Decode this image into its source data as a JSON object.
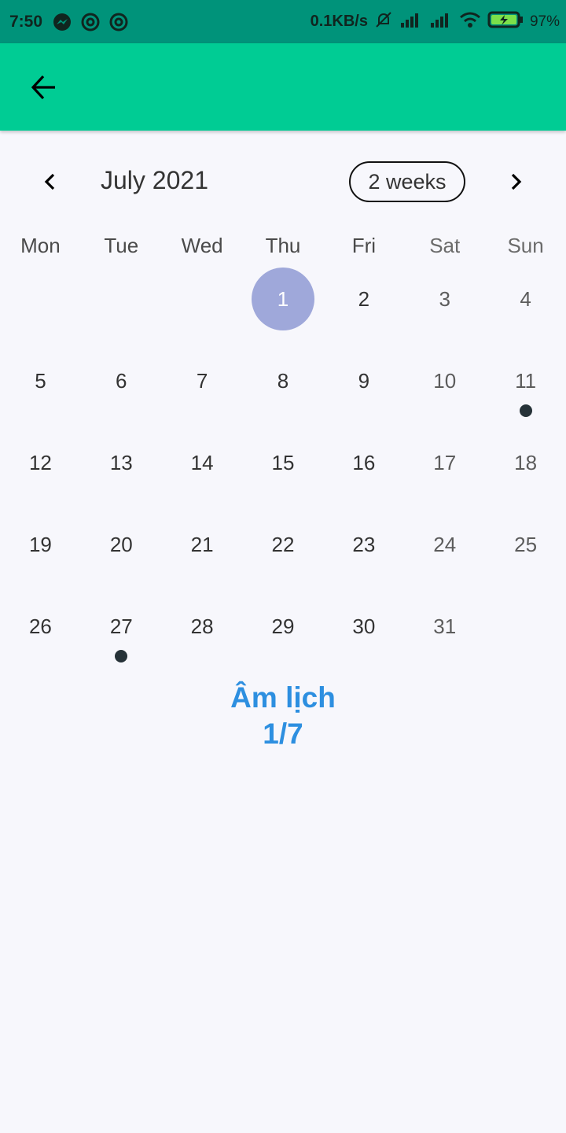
{
  "status_bar": {
    "time": "7:50",
    "network_speed": "0.1KB/s",
    "battery": "97%",
    "app_icons": [
      "messenger-icon",
      "notification-app-icon",
      "notification-app-icon"
    ],
    "colors": {
      "background": "#00937a"
    }
  },
  "app_bar": {
    "color": "#00cc94",
    "back_icon": "arrow-left-icon"
  },
  "calendar": {
    "month_title": "July 2021",
    "format_button": "2 weeks",
    "weekdays": [
      "Mon",
      "Tue",
      "Wed",
      "Thu",
      "Fri",
      "Sat",
      "Sun"
    ],
    "leading_blank_days": 3,
    "days": [
      "1",
      "2",
      "3",
      "4",
      "5",
      "6",
      "7",
      "8",
      "9",
      "10",
      "11",
      "12",
      "13",
      "14",
      "15",
      "16",
      "17",
      "18",
      "19",
      "20",
      "21",
      "22",
      "23",
      "24",
      "25",
      "26",
      "27",
      "28",
      "29",
      "30",
      "31"
    ],
    "selected_day": "1",
    "event_days": [
      "11",
      "27"
    ],
    "selected_color": "#9fa8da",
    "marker_color": "#263238"
  },
  "lunar": {
    "label": "Âm lịch",
    "date": "1/7",
    "color": "#2d8fe0"
  }
}
